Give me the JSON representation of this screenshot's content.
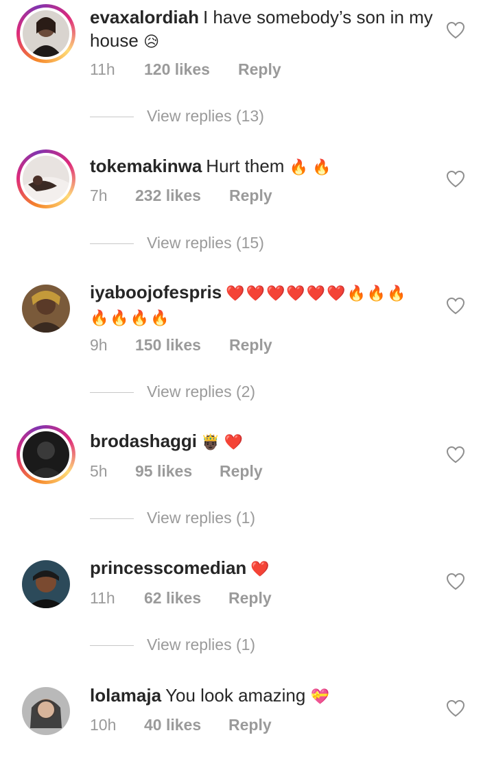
{
  "comments": [
    {
      "username": "evaxalordiah",
      "text": "I have somebody’s son in my house",
      "emoji": "😥",
      "time": "11h",
      "likes": "120 likes",
      "reply": "Reply",
      "view_replies": "View replies (13)"
    },
    {
      "username": "tokemakinwa",
      "text": "Hurt them",
      "emoji": "🔥 🔥",
      "time": "7h",
      "likes": "232 likes",
      "reply": "Reply",
      "view_replies": "View replies (15)"
    },
    {
      "username": "iyaboojofespris",
      "text": "",
      "emoji": "❤️❤️❤️❤️❤️❤️🔥🔥🔥🔥🔥🔥🔥",
      "time": "9h",
      "likes": "150 likes",
      "reply": "Reply",
      "view_replies": "View replies (2)"
    },
    {
      "username": "brodashaggi",
      "text": "",
      "emoji": "🤴🏿 ❤️",
      "time": "5h",
      "likes": "95 likes",
      "reply": "Reply",
      "view_replies": "View replies (1)"
    },
    {
      "username": "princesscomedian",
      "text": "",
      "emoji": "❤️",
      "time": "11h",
      "likes": "62 likes",
      "reply": "Reply",
      "view_replies": "View replies (1)"
    },
    {
      "username": "lolamaja",
      "text": "You look amazing",
      "emoji": "💝",
      "time": "10h",
      "likes": "40 likes",
      "reply": "Reply"
    }
  ],
  "icons": {
    "like": "heart-outline-icon"
  },
  "colors": {
    "text": "#262626",
    "meta": "#9a9a9a",
    "ring_start": "#f58529",
    "ring_end": "#dd2a7b"
  }
}
